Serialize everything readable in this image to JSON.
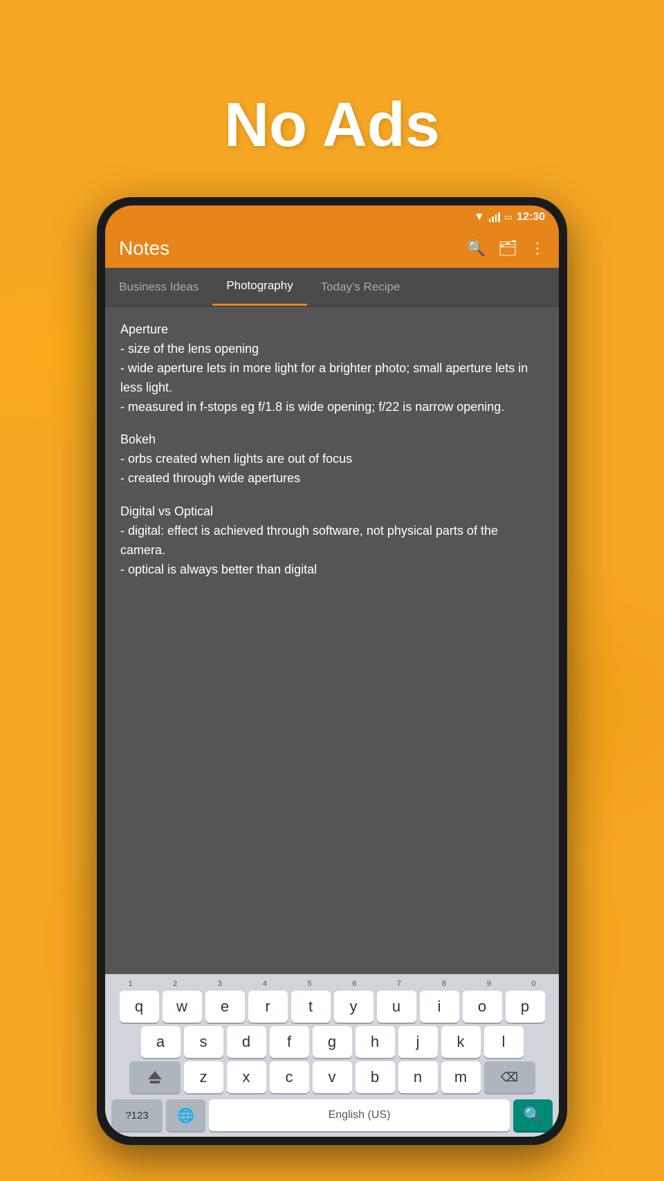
{
  "background": {
    "color": "#F5A623"
  },
  "hero": {
    "title": "No Ads"
  },
  "phone": {
    "status_bar": {
      "time": "12:30"
    },
    "app_header": {
      "title": "Notes"
    },
    "tabs": [
      {
        "label": "Business Ideas",
        "active": false
      },
      {
        "label": "Photography",
        "active": true
      },
      {
        "label": "Today's Recipe",
        "active": false
      }
    ],
    "note": {
      "content": "Aperture\n- size of the lens opening\n- wide aperture lets in more light for a brighter photo; small aperture lets in less light.\n- measured in f-stops eg f/1.8 is wide opening; f/22 is narrow opening.\n\nBokeh\n- orbs created when lights are out of focus\n- created through wide apertures\n\nDigital vs Optical\n- digital: effect is achieved through software, not physical parts of the camera.\n- optical is always better than digital"
    },
    "keyboard": {
      "number_row": [
        "1",
        "2",
        "3",
        "4",
        "5",
        "6",
        "7",
        "8",
        "9",
        "0"
      ],
      "row1": [
        "q",
        "w",
        "e",
        "r",
        "t",
        "y",
        "u",
        "i",
        "o",
        "p"
      ],
      "row2": [
        "a",
        "s",
        "d",
        "f",
        "g",
        "h",
        "j",
        "k",
        "l"
      ],
      "row3": [
        "z",
        "x",
        "c",
        "v",
        "b",
        "n",
        "m"
      ],
      "special_keys": {
        "shift": "⇧",
        "delete": "⌫",
        "numbers": "?123",
        "globe": "🌐",
        "space_placeholder": "English (US)",
        "search": "🔍"
      }
    }
  }
}
